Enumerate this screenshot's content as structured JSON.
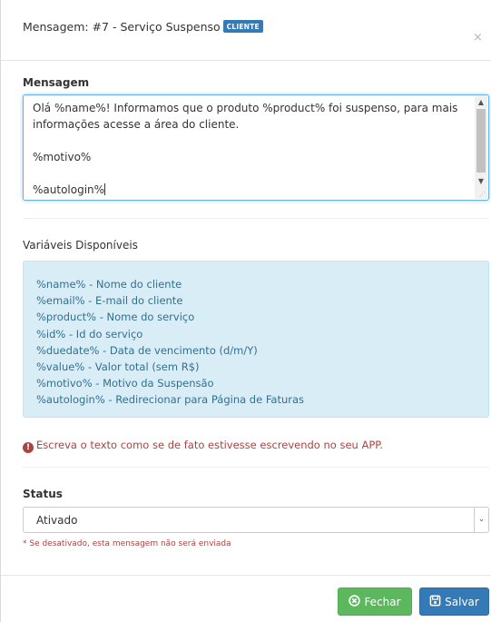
{
  "header": {
    "title": "Mensagem: #7 - Serviço Suspenso",
    "badge": "CLIENTE",
    "close_icon": "close-icon"
  },
  "message": {
    "label": "Mensagem",
    "lines": [
      "Olá %name%! Informamos que o produto %product% foi suspenso, para mais",
      "informações acesse a área do cliente.",
      "",
      "%motivo%",
      "",
      "%autologin%"
    ]
  },
  "variables": {
    "label": "Variáveis Disponíveis",
    "items": [
      "%name% - Nome do cliente",
      "%email% - E-mail do cliente",
      "%product% - Nome do serviço",
      "%id% - Id do serviço",
      "%duedate% - Data de vencimento (d/m/Y)",
      "%value% - Valor total (sem R$)",
      "%motivo% - Motivo da Suspensão",
      "%autologin% - Redirecionar para Página de Faturas"
    ],
    "box_color": "#d9edf7",
    "text_color": "#31708f"
  },
  "warning": {
    "icon": "exclamation-circle-icon",
    "text": "Escreva o texto como se de fato estivesse escrevendo no seu APP.",
    "color": "#a94442"
  },
  "status": {
    "label": "Status",
    "selected": "Ativado",
    "hint": "* Se desativado, esta mensagem não será enviada"
  },
  "footer": {
    "close_label": "Fechar",
    "close_icon": "times-circle-icon",
    "close_color": "#5cb85c",
    "save_label": "Salvar",
    "save_icon": "save-icon",
    "save_color": "#337ab7"
  }
}
